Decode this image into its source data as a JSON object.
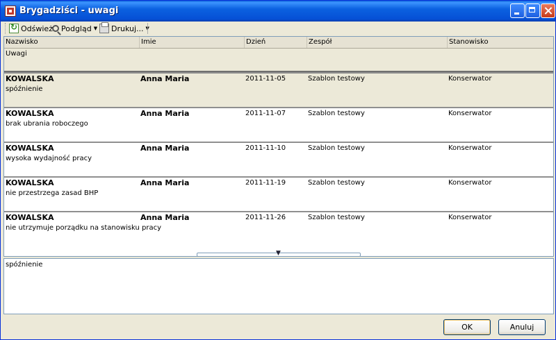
{
  "window": {
    "title": "Brygadziści - uwagi"
  },
  "toolbar": {
    "refresh": "Odśwież",
    "preview": "Podgląd",
    "print": "Drukuj..."
  },
  "columns": {
    "surname": "Nazwisko",
    "name": "Imie",
    "day": "Dzień",
    "team": "Zespół",
    "position": "Stanowisko",
    "remarks": "Uwagi"
  },
  "rows": [
    {
      "surname": "KOWALSKA",
      "name": "Anna Maria",
      "day": "2011-11-05",
      "team": "Szablon testowy",
      "position": "Konserwator",
      "remark": "spóźnienie"
    },
    {
      "surname": "KOWALSKA",
      "name": "Anna Maria",
      "day": "2011-11-07",
      "team": "Szablon testowy",
      "position": "Konserwator",
      "remark": "brak ubrania roboczego"
    },
    {
      "surname": "KOWALSKA",
      "name": "Anna Maria",
      "day": "2011-11-10",
      "team": "Szablon testowy",
      "position": "Konserwator",
      "remark": "wysoka wydajność pracy"
    },
    {
      "surname": "KOWALSKA",
      "name": "Anna Maria",
      "day": "2011-11-19",
      "team": "Szablon testowy",
      "position": "Konserwator",
      "remark": "nie przestrzega zasad BHP"
    },
    {
      "surname": "KOWALSKA",
      "name": "Anna Maria",
      "day": "2011-11-26",
      "team": "Szablon testowy",
      "position": "Konserwator",
      "remark": "nie utrzymuje porządku na stanowisku pracy"
    }
  ],
  "detail": {
    "text": "spóźnienie"
  },
  "buttons": {
    "ok": "OK",
    "cancel": "Anuluj"
  }
}
